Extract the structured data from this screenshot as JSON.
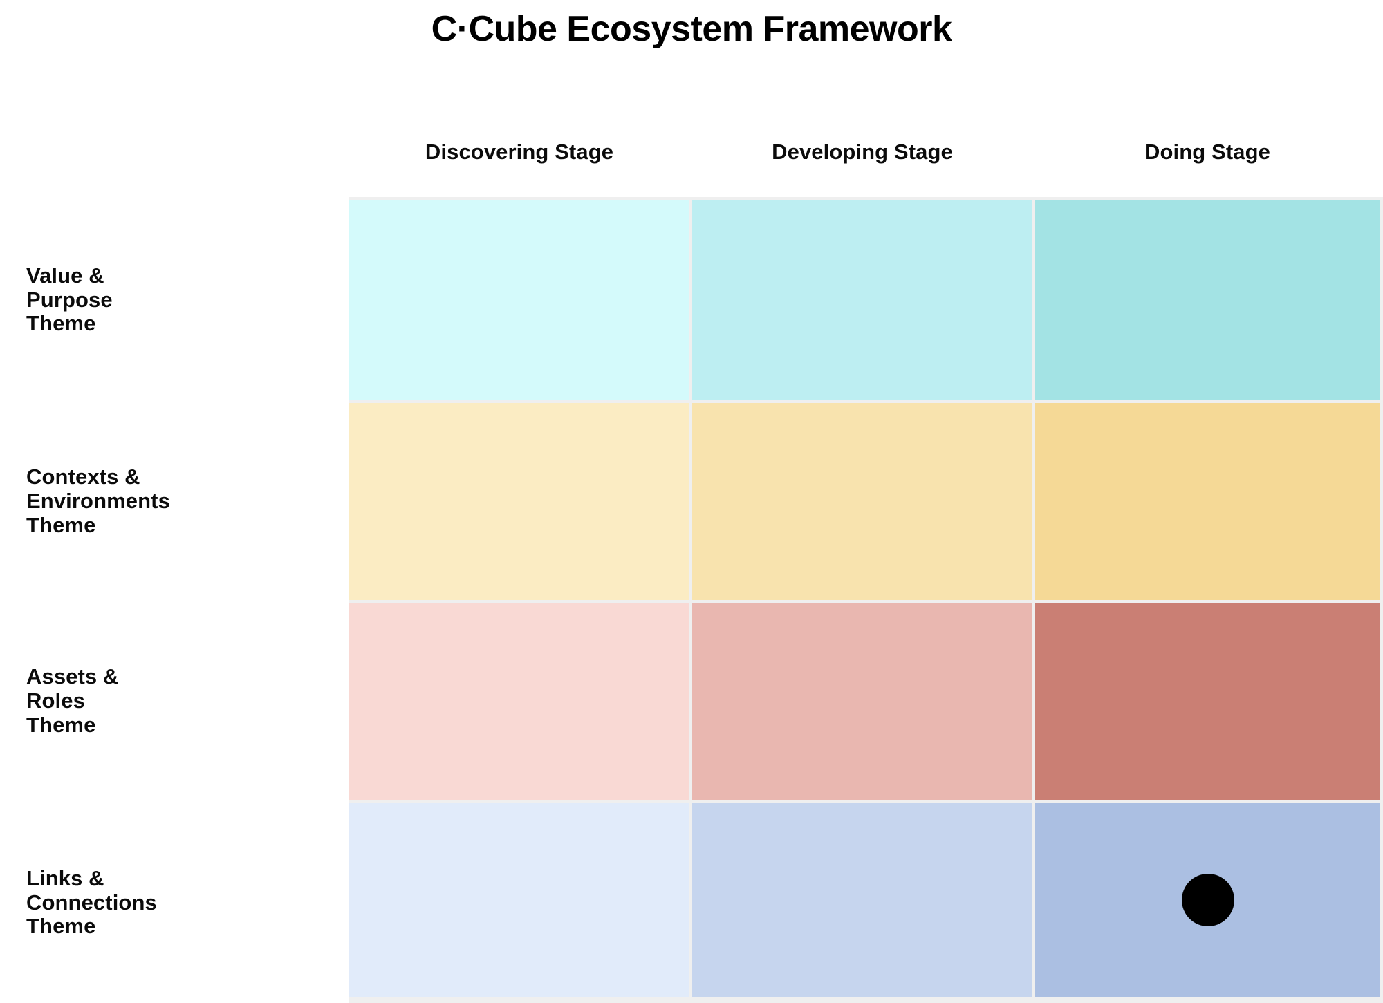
{
  "title": "C·Cube Ecosystem Framework",
  "colors": {
    "page_background": "#ffffff",
    "gutter": "#efefef",
    "header_text": "#0b0b0b",
    "marker": "#000000"
  },
  "marker": {
    "shape": "circle",
    "row": "Links & Connections Theme",
    "column": "Doing Stage",
    "color": "#000000"
  },
  "chart_data": {
    "type": "heatmap",
    "title": "C·Cube Ecosystem Framework",
    "xlabel": "",
    "ylabel": "",
    "grid": true,
    "legend": "none",
    "categories": [
      "Discovering Stage",
      "Developing Stage",
      "Doing Stage"
    ],
    "rows": [
      "Value & Purpose Theme",
      "Contexts & Environments Theme",
      "Assets & Roles Theme",
      "Links & Connections Theme"
    ],
    "row_lines": [
      [
        "Value &",
        "Purpose",
        "Theme"
      ],
      [
        "Contexts &",
        "Environments",
        "Theme"
      ],
      [
        "Assets &",
        "Roles",
        "Theme"
      ],
      [
        "Links &",
        "Connections",
        "Theme"
      ]
    ],
    "values": [
      [
        1,
        2,
        3
      ],
      [
        1,
        2,
        3
      ],
      [
        1,
        2,
        3
      ],
      [
        1,
        2,
        3
      ]
    ],
    "cell_colors": [
      [
        "#d4fafb",
        "#bdeef2",
        "#a3e3e4"
      ],
      [
        "#fbecc3",
        "#f8e3ae",
        "#f5d996"
      ],
      [
        "#f9d9d4",
        "#e9b7b0",
        "#ca7f74"
      ],
      [
        "#e1ebfa",
        "#c6d5ee",
        "#abbfe2"
      ]
    ]
  },
  "header": {
    "columns": [
      {
        "label": "Discovering Stage"
      },
      {
        "label": "Developing Stage"
      },
      {
        "label": "Doing Stage"
      }
    ]
  }
}
